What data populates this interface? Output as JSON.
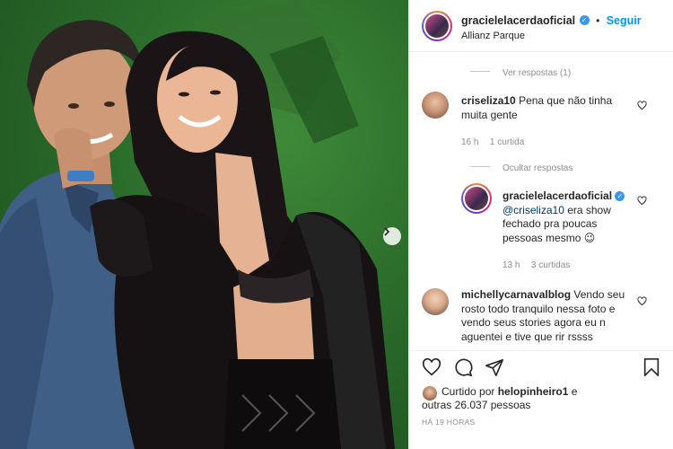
{
  "header": {
    "username": "gracielelacerdaoficial",
    "verified_badge": "✓",
    "separator": "•",
    "follow_label": "Seguir",
    "location": "Allianz Parque"
  },
  "comments": {
    "view_replies_label": "Ver respostas (1)",
    "items": [
      {
        "username": "criseliza10",
        "text": "Pena que não tinha muita gente",
        "time": "16 h",
        "likes": "1 curtida"
      }
    ],
    "hide_replies_label": "Ocultar respostas",
    "reply": {
      "username": "gracielelacerdaoficial",
      "verified_badge": "✓",
      "mention": "@criseliza10",
      "text": " era show fechado pra poucas pessoas mesmo 😉",
      "time": "13 h",
      "likes": "3 curtidas"
    },
    "next": {
      "username": "michellycarnavalblog",
      "text": "Vendo seu rosto todo tranquilo nessa foto e vendo seus stories agora eu n aguentei e tive que rir rssss"
    }
  },
  "actions": {
    "liked_by_prefix": "Curtido por ",
    "liked_by_user": "helopinheiro1",
    "liked_by_suffix": " e",
    "others_line": "outras 26.037 pessoas",
    "posted_ago": "HÁ 19 HORAS"
  },
  "icons": {
    "heart": "heart-icon",
    "comment": "comment-icon",
    "share": "share-icon",
    "save": "bookmark-icon",
    "next": "chevron-right-icon"
  },
  "colors": {
    "accent": "#0095f6",
    "muted": "#8e8e8e",
    "background_photo": "#2a6b2a"
  }
}
